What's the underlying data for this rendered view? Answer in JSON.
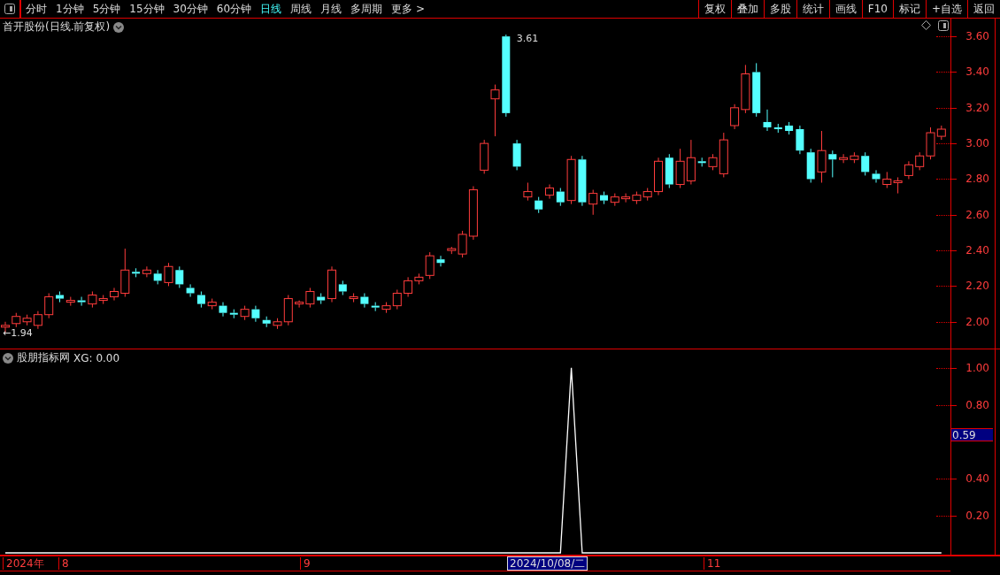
{
  "toolbar": {
    "periods": [
      {
        "label": "分时",
        "selected": false
      },
      {
        "label": "1分钟",
        "selected": false
      },
      {
        "label": "5分钟",
        "selected": false
      },
      {
        "label": "15分钟",
        "selected": false
      },
      {
        "label": "30分钟",
        "selected": false
      },
      {
        "label": "60分钟",
        "selected": false
      },
      {
        "label": "日线",
        "selected": true
      },
      {
        "label": "周线",
        "selected": false
      },
      {
        "label": "月线",
        "selected": false
      },
      {
        "label": "多周期",
        "selected": false
      },
      {
        "label": "更多 >",
        "selected": false
      }
    ],
    "buttons": [
      "复权",
      "叠加",
      "多股",
      "统计",
      "画线",
      "F10",
      "标记",
      "+自选",
      "返回"
    ]
  },
  "price_pane": {
    "title": "首开股份(日线.前复权)",
    "high_marker": "3.61",
    "low_marker": "←1.94",
    "chart_data": {
      "type": "candlestick",
      "ylim": [
        1.85,
        3.7
      ],
      "yticks": [
        {
          "value": 3.6,
          "label": "3.60"
        },
        {
          "value": 3.4,
          "label": "3.40"
        },
        {
          "value": 3.2,
          "label": "3.20"
        },
        {
          "value": 3.0,
          "label": "3.00"
        },
        {
          "value": 2.8,
          "label": "2.80"
        },
        {
          "value": 2.6,
          "label": "2.60"
        },
        {
          "value": 2.4,
          "label": "2.40"
        },
        {
          "value": 2.2,
          "label": "2.20"
        },
        {
          "value": 2.0,
          "label": "2.00"
        }
      ],
      "ohlc": [
        [
          1.97,
          2.0,
          1.94,
          1.98
        ],
        [
          1.99,
          2.05,
          1.97,
          2.03
        ],
        [
          2.0,
          2.04,
          1.98,
          2.02
        ],
        [
          1.98,
          2.06,
          1.96,
          2.04
        ],
        [
          2.04,
          2.16,
          2.02,
          2.14
        ],
        [
          2.15,
          2.17,
          2.11,
          2.13
        ],
        [
          2.11,
          2.14,
          2.09,
          2.12
        ],
        [
          2.12,
          2.14,
          2.09,
          2.11
        ],
        [
          2.1,
          2.17,
          2.08,
          2.15
        ],
        [
          2.12,
          2.15,
          2.1,
          2.13
        ],
        [
          2.14,
          2.19,
          2.12,
          2.17
        ],
        [
          2.16,
          2.41,
          2.14,
          2.29
        ],
        [
          2.28,
          2.3,
          2.25,
          2.27
        ],
        [
          2.27,
          2.31,
          2.25,
          2.29
        ],
        [
          2.27,
          2.29,
          2.21,
          2.23
        ],
        [
          2.22,
          2.33,
          2.2,
          2.31
        ],
        [
          2.29,
          2.31,
          2.19,
          2.21
        ],
        [
          2.19,
          2.21,
          2.14,
          2.16
        ],
        [
          2.15,
          2.17,
          2.08,
          2.1
        ],
        [
          2.09,
          2.13,
          2.07,
          2.11
        ],
        [
          2.09,
          2.11,
          2.03,
          2.05
        ],
        [
          2.05,
          2.07,
          2.02,
          2.04
        ],
        [
          2.03,
          2.09,
          2.01,
          2.07
        ],
        [
          2.07,
          2.09,
          2.0,
          2.02
        ],
        [
          2.01,
          2.03,
          1.97,
          1.99
        ],
        [
          1.98,
          2.02,
          1.96,
          2.0
        ],
        [
          2.0,
          2.15,
          1.98,
          2.13
        ],
        [
          2.1,
          2.12,
          2.08,
          2.11
        ],
        [
          2.1,
          2.19,
          2.08,
          2.17
        ],
        [
          2.14,
          2.16,
          2.1,
          2.12
        ],
        [
          2.13,
          2.31,
          2.11,
          2.29
        ],
        [
          2.21,
          2.23,
          2.15,
          2.17
        ],
        [
          2.13,
          2.16,
          2.11,
          2.14
        ],
        [
          2.14,
          2.16,
          2.08,
          2.1
        ],
        [
          2.09,
          2.11,
          2.06,
          2.08
        ],
        [
          2.07,
          2.11,
          2.05,
          2.09
        ],
        [
          2.09,
          2.18,
          2.07,
          2.16
        ],
        [
          2.16,
          2.25,
          2.14,
          2.23
        ],
        [
          2.23,
          2.27,
          2.21,
          2.25
        ],
        [
          2.26,
          2.39,
          2.24,
          2.37
        ],
        [
          2.35,
          2.37,
          2.31,
          2.33
        ],
        [
          2.4,
          2.42,
          2.38,
          2.41
        ],
        [
          2.38,
          2.51,
          2.36,
          2.49
        ],
        [
          2.48,
          2.76,
          2.46,
          2.74
        ],
        [
          2.85,
          3.02,
          2.83,
          3.0
        ],
        [
          3.25,
          3.33,
          3.04,
          3.3
        ],
        [
          3.6,
          3.61,
          3.15,
          3.17
        ],
        [
          3.0,
          3.02,
          2.85,
          2.87
        ],
        [
          2.7,
          2.78,
          2.68,
          2.73
        ],
        [
          2.68,
          2.7,
          2.61,
          2.63
        ],
        [
          2.71,
          2.77,
          2.69,
          2.75
        ],
        [
          2.73,
          2.75,
          2.65,
          2.67
        ],
        [
          2.68,
          2.93,
          2.66,
          2.91
        ],
        [
          2.91,
          2.93,
          2.65,
          2.67
        ],
        [
          2.66,
          2.74,
          2.6,
          2.72
        ],
        [
          2.71,
          2.73,
          2.66,
          2.68
        ],
        [
          2.67,
          2.72,
          2.65,
          2.7
        ],
        [
          2.69,
          2.72,
          2.67,
          2.7
        ],
        [
          2.68,
          2.73,
          2.66,
          2.71
        ],
        [
          2.7,
          2.75,
          2.68,
          2.73
        ],
        [
          2.73,
          2.92,
          2.71,
          2.9
        ],
        [
          2.92,
          2.94,
          2.75,
          2.77
        ],
        [
          2.77,
          2.97,
          2.75,
          2.9
        ],
        [
          2.79,
          3.02,
          2.77,
          2.92
        ],
        [
          2.9,
          2.92,
          2.87,
          2.89
        ],
        [
          2.87,
          2.94,
          2.85,
          2.92
        ],
        [
          2.83,
          3.06,
          2.81,
          3.02
        ],
        [
          3.1,
          3.22,
          3.08,
          3.2
        ],
        [
          3.19,
          3.44,
          3.17,
          3.39
        ],
        [
          3.4,
          3.45,
          3.15,
          3.17
        ],
        [
          3.12,
          3.19,
          3.07,
          3.09
        ],
        [
          3.09,
          3.11,
          3.06,
          3.08
        ],
        [
          3.1,
          3.12,
          3.05,
          3.07
        ],
        [
          3.08,
          3.1,
          2.94,
          2.96
        ],
        [
          2.95,
          2.97,
          2.78,
          2.8
        ],
        [
          2.84,
          3.07,
          2.78,
          2.96
        ],
        [
          2.94,
          2.96,
          2.81,
          2.91
        ],
        [
          2.91,
          2.94,
          2.89,
          2.92
        ],
        [
          2.91,
          2.95,
          2.89,
          2.93
        ],
        [
          2.93,
          2.95,
          2.82,
          2.84
        ],
        [
          2.83,
          2.85,
          2.78,
          2.8
        ],
        [
          2.77,
          2.84,
          2.75,
          2.8
        ],
        [
          2.78,
          2.81,
          2.72,
          2.79
        ],
        [
          2.82,
          2.9,
          2.8,
          2.88
        ],
        [
          2.87,
          2.95,
          2.85,
          2.93
        ],
        [
          2.93,
          3.09,
          2.91,
          3.06
        ],
        [
          3.04,
          3.1,
          3.02,
          3.08
        ]
      ]
    }
  },
  "indicator_pane": {
    "title": "股朋指标网",
    "legend_suffix": ": 0.00",
    "cursor_reading": "0.59",
    "chart_data": {
      "type": "line",
      "ylim": [
        0,
        1.1
      ],
      "yticks": [
        {
          "value": 0.2,
          "label": "0.20"
        },
        {
          "value": 0.4,
          "label": "0.40"
        },
        {
          "value": 0.8,
          "label": "0.80"
        },
        {
          "value": 1,
          "label": "1.00"
        }
      ],
      "series": [
        {
          "name": "XG",
          "color": "#ffffff",
          "values": [
            0,
            0,
            0,
            0,
            0,
            0,
            0,
            0,
            0,
            0,
            0,
            0,
            0,
            0,
            0,
            0,
            0,
            0,
            0,
            0,
            0,
            0,
            0,
            0,
            0,
            0,
            0,
            0,
            0,
            0,
            0,
            0,
            0,
            0,
            0,
            0,
            0,
            0,
            0,
            0,
            0,
            0,
            0,
            0,
            0,
            0,
            0,
            0,
            0,
            0,
            0,
            0,
            1,
            0,
            0,
            0,
            0,
            0,
            0,
            0,
            0,
            0,
            0,
            0,
            0,
            0,
            0,
            0,
            0,
            0,
            0,
            0,
            0,
            0,
            0,
            0,
            0,
            0,
            0,
            0,
            0,
            0,
            0,
            0,
            0,
            0,
            0
          ]
        }
      ]
    }
  },
  "time_axis": [
    {
      "text": "2024年",
      "kind": "year"
    },
    {
      "text": "8",
      "kind": "month"
    },
    {
      "text": "9",
      "kind": "month"
    },
    {
      "text": "2024/10/08/二",
      "kind": "cursor"
    },
    {
      "text": "11",
      "kind": "month"
    }
  ]
}
